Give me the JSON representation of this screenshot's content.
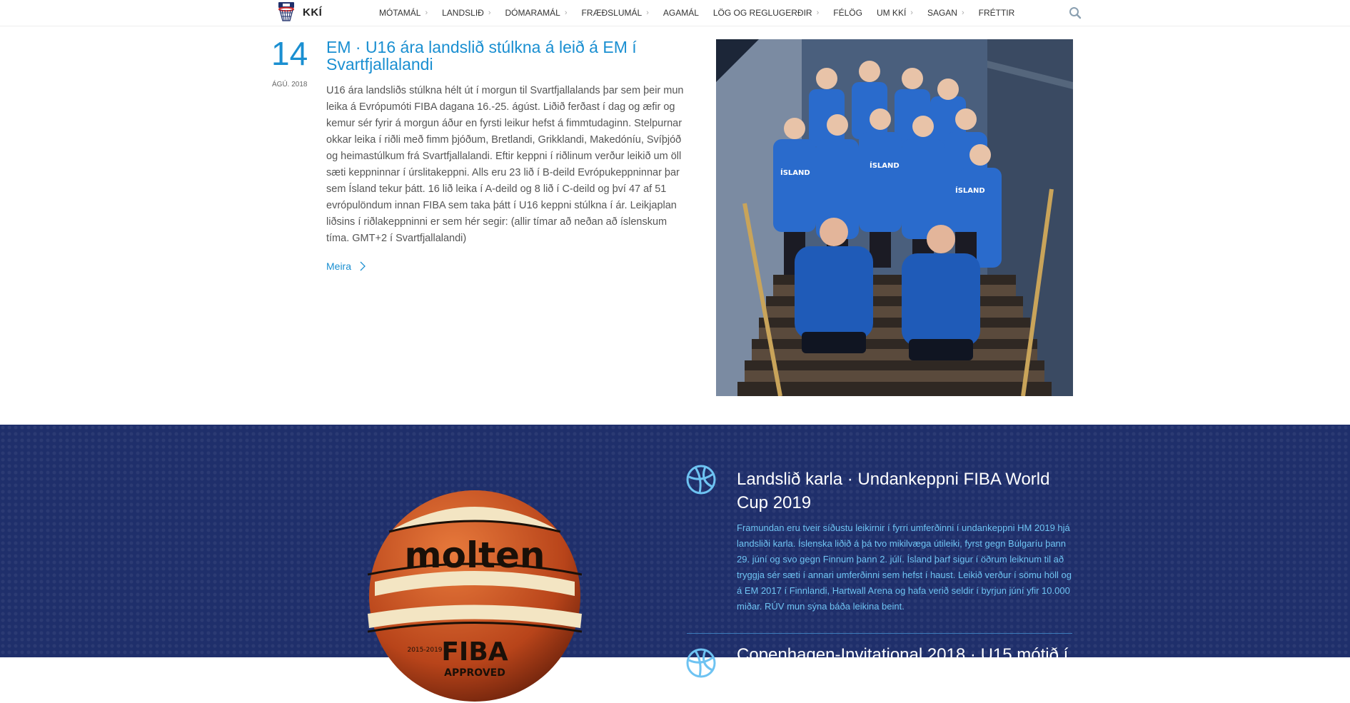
{
  "brand": {
    "logo_text": "KKÍ",
    "logo_icon": "basketball-hoop-icon"
  },
  "nav": [
    {
      "label": "MÓTAMÁL",
      "has_submenu": true
    },
    {
      "label": "LANDSLIÐ",
      "has_submenu": true
    },
    {
      "label": "DÓMARAMÁL",
      "has_submenu": true
    },
    {
      "label": "FRÆÐSLUMÁL",
      "has_submenu": true
    },
    {
      "label": "AGAMÁL",
      "has_submenu": false
    },
    {
      "label": "LÖG OG REGLUGERÐIR",
      "has_submenu": true
    },
    {
      "label": "FÉLÖG",
      "has_submenu": false
    },
    {
      "label": "UM KKÍ",
      "has_submenu": true
    },
    {
      "label": "SAGAN",
      "has_submenu": true
    },
    {
      "label": "FRÉTTIR",
      "has_submenu": false
    }
  ],
  "search_icon": "search-icon",
  "article": {
    "day": "14",
    "month_year": "ÁGÚ. 2018",
    "title": "EM · U16 ára landslið stúlkna á leið á EM í Svartfjallalandi",
    "body": "U16 ára landsliðs stúlkna hélt út í morgun til Svartfjallalands þar sem þeir mun leika á Evrópumóti FIBA dagana 16.-25. ágúst. Liðið ferðast í dag og æfir og kemur sér fyrir á morgun áður en fyrsti leikur hefst á fimmtudaginn. Stelpurnar okkar leika í riðli með fimm þjóðum, Bretlandi, Grikklandi, Makedóníu, Svíþjóð og heimastúlkum frá Svartfjallalandi. Eftir keppni í riðlinum verður leikið um öll sæti keppninnar í úrslitakeppni. Alls eru 23 lið í B-deild Evrópukeppninnar þar sem Ísland tekur þátt. 16 lið leika í A-deild og 8 lið í C-deild og því 47 af 51 evrópulöndum innan FIBA sem taka þátt í U16 keppni stúlkna í ár. Leikjaplan liðsins í riðlakeppninni er sem hér segir: (allir tímar að neðan að íslenskum tíma. GMT+2 í Svartfjallalandi)",
    "more_label": "Meira",
    "photo_jersey_text": "ÍSLAND"
  },
  "feature": {
    "ball_brand": "molten",
    "ball_text": "FIBA",
    "ball_subtext": "APPROVED",
    "ball_years": "2015-2019",
    "items": [
      {
        "icon": "basketball-icon",
        "title": "Landslið karla · Undankeppni FIBA World Cup 2019",
        "body": "Framundan eru tveir síðustu leikirnir í fyrri umferðinni í undankeppni HM 2019 hjá landsliði karla. Íslenska liðið á þá tvo mikilvæga útileiki, fyrst gegn Búlgaríu þann 29. júní og svo gegn Finnum þann 2. júlí. Ísland þarf sigur í öðrum leiknum til að tryggja sér sæti í annari umferðinni sem hefst í haust. Leikið verður í sömu höll og á EM 2017 í Finnlandi, Hartwall Arena og hafa verið seldir í byrjun júní yfir 10.000 miðar. RÚV mun sýna báða leikina beint."
      },
      {
        "icon": "basketball-icon",
        "title": "Copenhagen-Invitational 2018 · U15 mótið í"
      }
    ]
  },
  "colors": {
    "accent": "#1a8fd1",
    "section_bg": "#1f2f6b",
    "feature_text": "#6ec3f2"
  }
}
